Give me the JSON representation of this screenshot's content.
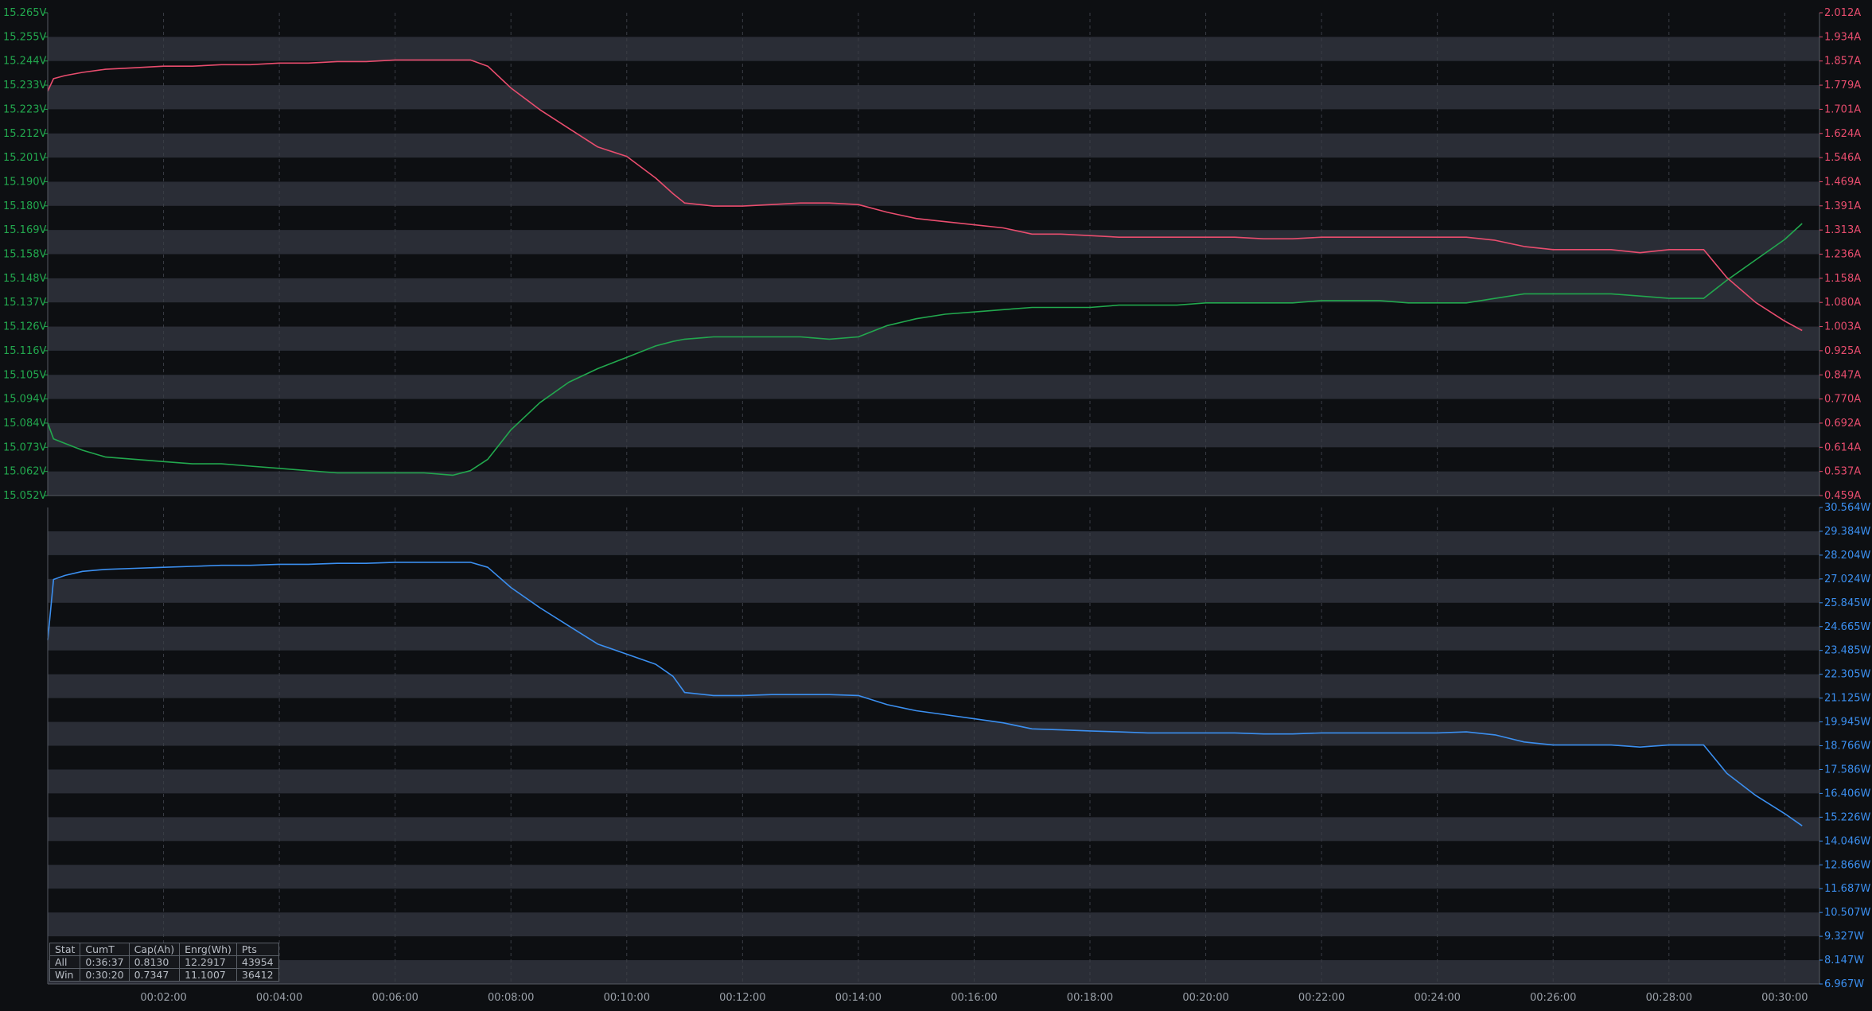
{
  "colors": {
    "background": "#0d0f12",
    "band": "#2a2d36",
    "voltage": "#22a84e",
    "current": "#e94d6e",
    "power": "#3b8ff0",
    "tick_text": "#9aa0a8",
    "grid": "#3a3d45"
  },
  "chart_data": [
    {
      "type": "line",
      "panel": "top",
      "x_unit": "minutes",
      "xlim": [
        0,
        30.6
      ],
      "x_tick_labels": [
        "00:02:00",
        "00:04:00",
        "00:06:00",
        "00:08:00",
        "00:10:00",
        "00:12:00",
        "00:14:00",
        "00:16:00",
        "00:18:00",
        "00:20:00",
        "00:22:00",
        "00:24:00",
        "00:26:00",
        "00:28:00",
        "00:30:00"
      ],
      "left_axis": {
        "unit": "V",
        "ylim": [
          15.052,
          15.265
        ],
        "tick_labels": [
          "15.265V",
          "15.255V",
          "15.244V",
          "15.233V",
          "15.223V",
          "15.212V",
          "15.201V",
          "15.190V",
          "15.180V",
          "15.169V",
          "15.158V",
          "15.148V",
          "15.137V",
          "15.126V",
          "15.116V",
          "15.105V",
          "15.094V",
          "15.084V",
          "15.073V",
          "15.062V",
          "15.052V"
        ]
      },
      "right_axis": {
        "unit": "A",
        "ylim": [
          0.459,
          2.012
        ],
        "tick_labels": [
          "2.012A",
          "1.934A",
          "1.857A",
          "1.779A",
          "1.701A",
          "1.624A",
          "1.546A",
          "1.469A",
          "1.391A",
          "1.313A",
          "1.236A",
          "1.158A",
          "1.080A",
          "1.003A",
          "0.925A",
          "0.847A",
          "0.770A",
          "0.692A",
          "0.614A",
          "0.537A",
          "0.459A"
        ]
      },
      "series": [
        {
          "axis": "left",
          "color": "#22a84e",
          "x": [
            0,
            0.1,
            0.3,
            0.6,
            1,
            1.5,
            2,
            2.5,
            3,
            3.5,
            4,
            4.5,
            5,
            5.5,
            6,
            6.5,
            7,
            7.3,
            7.6,
            8,
            8.5,
            9,
            9.5,
            10,
            10.5,
            10.8,
            11,
            11.5,
            12,
            12.5,
            13,
            13.5,
            14,
            14.5,
            15,
            15.5,
            16,
            16.5,
            17,
            17.5,
            18,
            18.5,
            19,
            19.5,
            20,
            20.5,
            21,
            21.5,
            22,
            22.5,
            23,
            23.5,
            24,
            24.5,
            25,
            25.5,
            26,
            26.5,
            27,
            27.5,
            28,
            28.6,
            29,
            29.5,
            30,
            30.3
          ],
          "y": [
            15.084,
            15.077,
            15.075,
            15.072,
            15.069,
            15.068,
            15.067,
            15.066,
            15.066,
            15.065,
            15.064,
            15.063,
            15.062,
            15.062,
            15.062,
            15.062,
            15.061,
            15.063,
            15.068,
            15.081,
            15.093,
            15.102,
            15.108,
            15.113,
            15.118,
            15.12,
            15.121,
            15.122,
            15.122,
            15.122,
            15.122,
            15.121,
            15.122,
            15.127,
            15.13,
            15.132,
            15.133,
            15.134,
            15.135,
            15.135,
            15.135,
            15.136,
            15.136,
            15.136,
            15.137,
            15.137,
            15.137,
            15.137,
            15.138,
            15.138,
            15.138,
            15.137,
            15.137,
            15.137,
            15.139,
            15.141,
            15.141,
            15.141,
            15.141,
            15.14,
            15.139,
            15.139,
            15.147,
            15.156,
            15.165,
            15.172
          ]
        },
        {
          "axis": "right",
          "color": "#e94d6e",
          "x": [
            0,
            0.1,
            0.3,
            0.6,
            1,
            1.5,
            2,
            2.5,
            3,
            3.5,
            4,
            4.5,
            5,
            5.5,
            6,
            6.5,
            7,
            7.3,
            7.6,
            8,
            8.5,
            9,
            9.5,
            10,
            10.5,
            10.8,
            11,
            11.5,
            12,
            12.5,
            13,
            13.5,
            14,
            14.5,
            15,
            15.5,
            16,
            16.5,
            17,
            17.5,
            18,
            18.5,
            19,
            19.5,
            20,
            20.5,
            21,
            21.5,
            22,
            22.5,
            23,
            23.5,
            24,
            24.5,
            25,
            25.5,
            26,
            26.5,
            27,
            27.5,
            28,
            28.6,
            29,
            29.5,
            30,
            30.3
          ],
          "y": [
            1.76,
            1.8,
            1.81,
            1.82,
            1.83,
            1.835,
            1.84,
            1.84,
            1.845,
            1.845,
            1.85,
            1.85,
            1.855,
            1.855,
            1.86,
            1.86,
            1.86,
            1.86,
            1.84,
            1.77,
            1.7,
            1.64,
            1.58,
            1.55,
            1.48,
            1.43,
            1.4,
            1.39,
            1.39,
            1.395,
            1.4,
            1.4,
            1.395,
            1.37,
            1.35,
            1.34,
            1.33,
            1.32,
            1.3,
            1.3,
            1.295,
            1.29,
            1.29,
            1.29,
            1.29,
            1.29,
            1.285,
            1.285,
            1.29,
            1.29,
            1.29,
            1.29,
            1.29,
            1.29,
            1.28,
            1.26,
            1.25,
            1.25,
            1.25,
            1.24,
            1.25,
            1.25,
            1.16,
            1.08,
            1.02,
            0.99
          ]
        }
      ]
    },
    {
      "type": "line",
      "panel": "bottom",
      "x_unit": "minutes",
      "xlim": [
        0,
        30.6
      ],
      "right_axis": {
        "unit": "W",
        "ylim": [
          6.967,
          30.564
        ],
        "tick_labels": [
          "30.564W",
          "29.384W",
          "28.204W",
          "27.024W",
          "25.845W",
          "24.665W",
          "23.485W",
          "22.305W",
          "21.125W",
          "19.945W",
          "18.766W",
          "17.586W",
          "16.406W",
          "15.226W",
          "14.046W",
          "12.866W",
          "11.687W",
          "10.507W",
          "9.327W",
          "8.147W",
          "6.967W"
        ]
      },
      "series": [
        {
          "axis": "right",
          "color": "#3b8ff0",
          "x": [
            0,
            0.1,
            0.3,
            0.6,
            1,
            1.5,
            2,
            2.5,
            3,
            3.5,
            4,
            4.5,
            5,
            5.5,
            6,
            6.5,
            7,
            7.3,
            7.6,
            8,
            8.5,
            9,
            9.5,
            10,
            10.5,
            10.8,
            11,
            11.5,
            12,
            12.5,
            13,
            13.5,
            14,
            14.5,
            15,
            15.5,
            16,
            16.5,
            17,
            17.5,
            18,
            18.5,
            19,
            19.5,
            20,
            20.5,
            21,
            21.5,
            22,
            22.5,
            23,
            23.5,
            24,
            24.5,
            25,
            25.5,
            26,
            26.5,
            27,
            27.5,
            28,
            28.6,
            29,
            29.5,
            30,
            30.3
          ],
          "y": [
            24.0,
            27.0,
            27.2,
            27.4,
            27.5,
            27.55,
            27.6,
            27.65,
            27.7,
            27.7,
            27.75,
            27.75,
            27.8,
            27.8,
            27.85,
            27.85,
            27.85,
            27.85,
            27.6,
            26.6,
            25.6,
            24.7,
            23.8,
            23.3,
            22.8,
            22.2,
            21.4,
            21.25,
            21.25,
            21.3,
            21.3,
            21.3,
            21.25,
            20.8,
            20.5,
            20.3,
            20.1,
            19.9,
            19.6,
            19.55,
            19.5,
            19.45,
            19.4,
            19.4,
            19.4,
            19.4,
            19.35,
            19.35,
            19.4,
            19.4,
            19.4,
            19.4,
            19.4,
            19.45,
            19.3,
            18.95,
            18.8,
            18.8,
            18.8,
            18.7,
            18.8,
            18.8,
            17.4,
            16.3,
            15.4,
            14.8
          ]
        }
      ]
    }
  ],
  "stats": {
    "headers": [
      "Stat",
      "CumT",
      "Cap(Ah)",
      "Enrg(Wh)",
      "Pts"
    ],
    "rows": [
      [
        "All",
        "0:36:37",
        "0.8130",
        "12.2917",
        "43954"
      ],
      [
        "Win",
        "0:30:20",
        "0.7347",
        "11.1007",
        "36412"
      ]
    ]
  }
}
